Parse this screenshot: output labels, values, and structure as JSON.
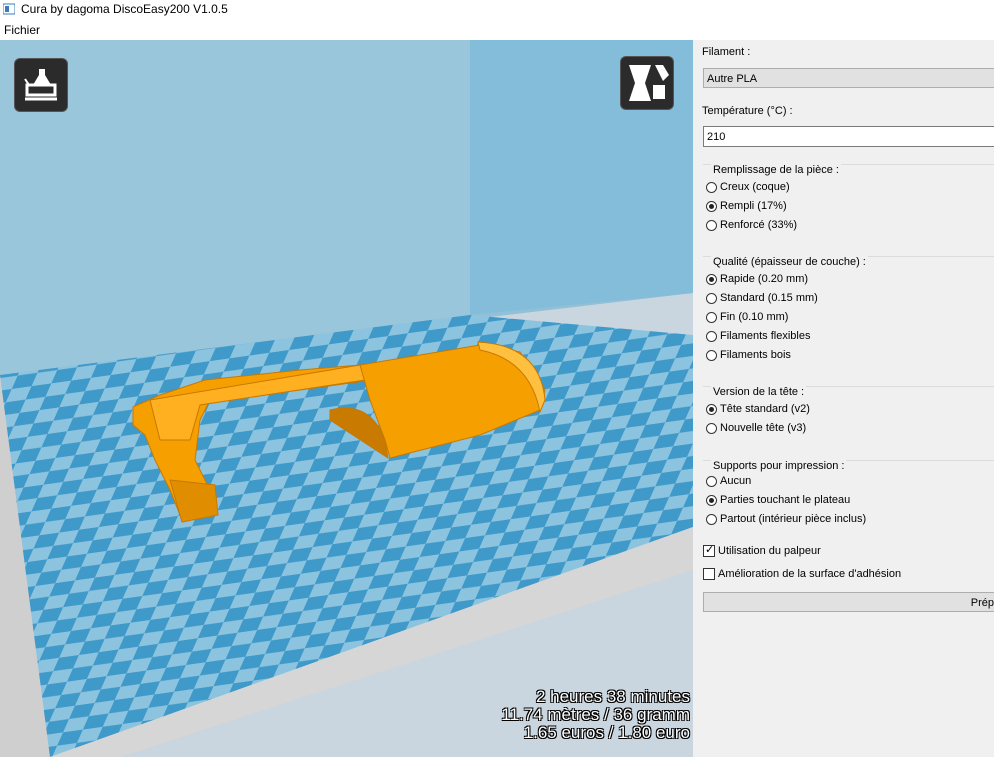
{
  "window": {
    "title": "Cura by dagoma DiscoEasy200 V1.0.5"
  },
  "menu": {
    "file": "Fichier"
  },
  "viewport": {
    "stats": {
      "time": "2 heures 38 minutes",
      "material": "11.74 mètres / 36 gramm",
      "cost": "1.65 euros / 1.80 euro"
    },
    "colors": {
      "model": "#f5a000",
      "bed_light": "#8cc3df",
      "bed_dark": "#3f99c9",
      "wall": "#88bfd8"
    }
  },
  "settings": {
    "filament_label": "Filament :",
    "filament_value": "Autre PLA",
    "temperature_label": "Température (°C) :",
    "temperature_value": "210",
    "infill": {
      "title": "Remplissage de la pièce :",
      "options": [
        "Creux (coque)",
        "Rempli (17%)",
        "Renforcé (33%)"
      ],
      "selected": 1
    },
    "quality": {
      "title": "Qualité (épaisseur de couche) :",
      "options": [
        "Rapide (0.20 mm)",
        "Standard (0.15 mm)",
        "Fin (0.10 mm)",
        "Filaments flexibles",
        "Filaments bois"
      ],
      "selected": 0
    },
    "head": {
      "title": "Version de la tête :",
      "options": [
        "Tête standard (v2)",
        "Nouvelle tête (v3)"
      ],
      "selected": 0
    },
    "supports": {
      "title": "Supports pour impression :",
      "options": [
        "Aucun",
        "Parties touchant le plateau",
        "Partout (intérieur pièce inclus)"
      ],
      "selected": 1
    },
    "probe_label": "Utilisation du palpeur",
    "probe_checked": true,
    "adhesion_label": "Amélioration de la surface d'adhésion",
    "adhesion_checked": false,
    "prepare_label": "Prép"
  }
}
